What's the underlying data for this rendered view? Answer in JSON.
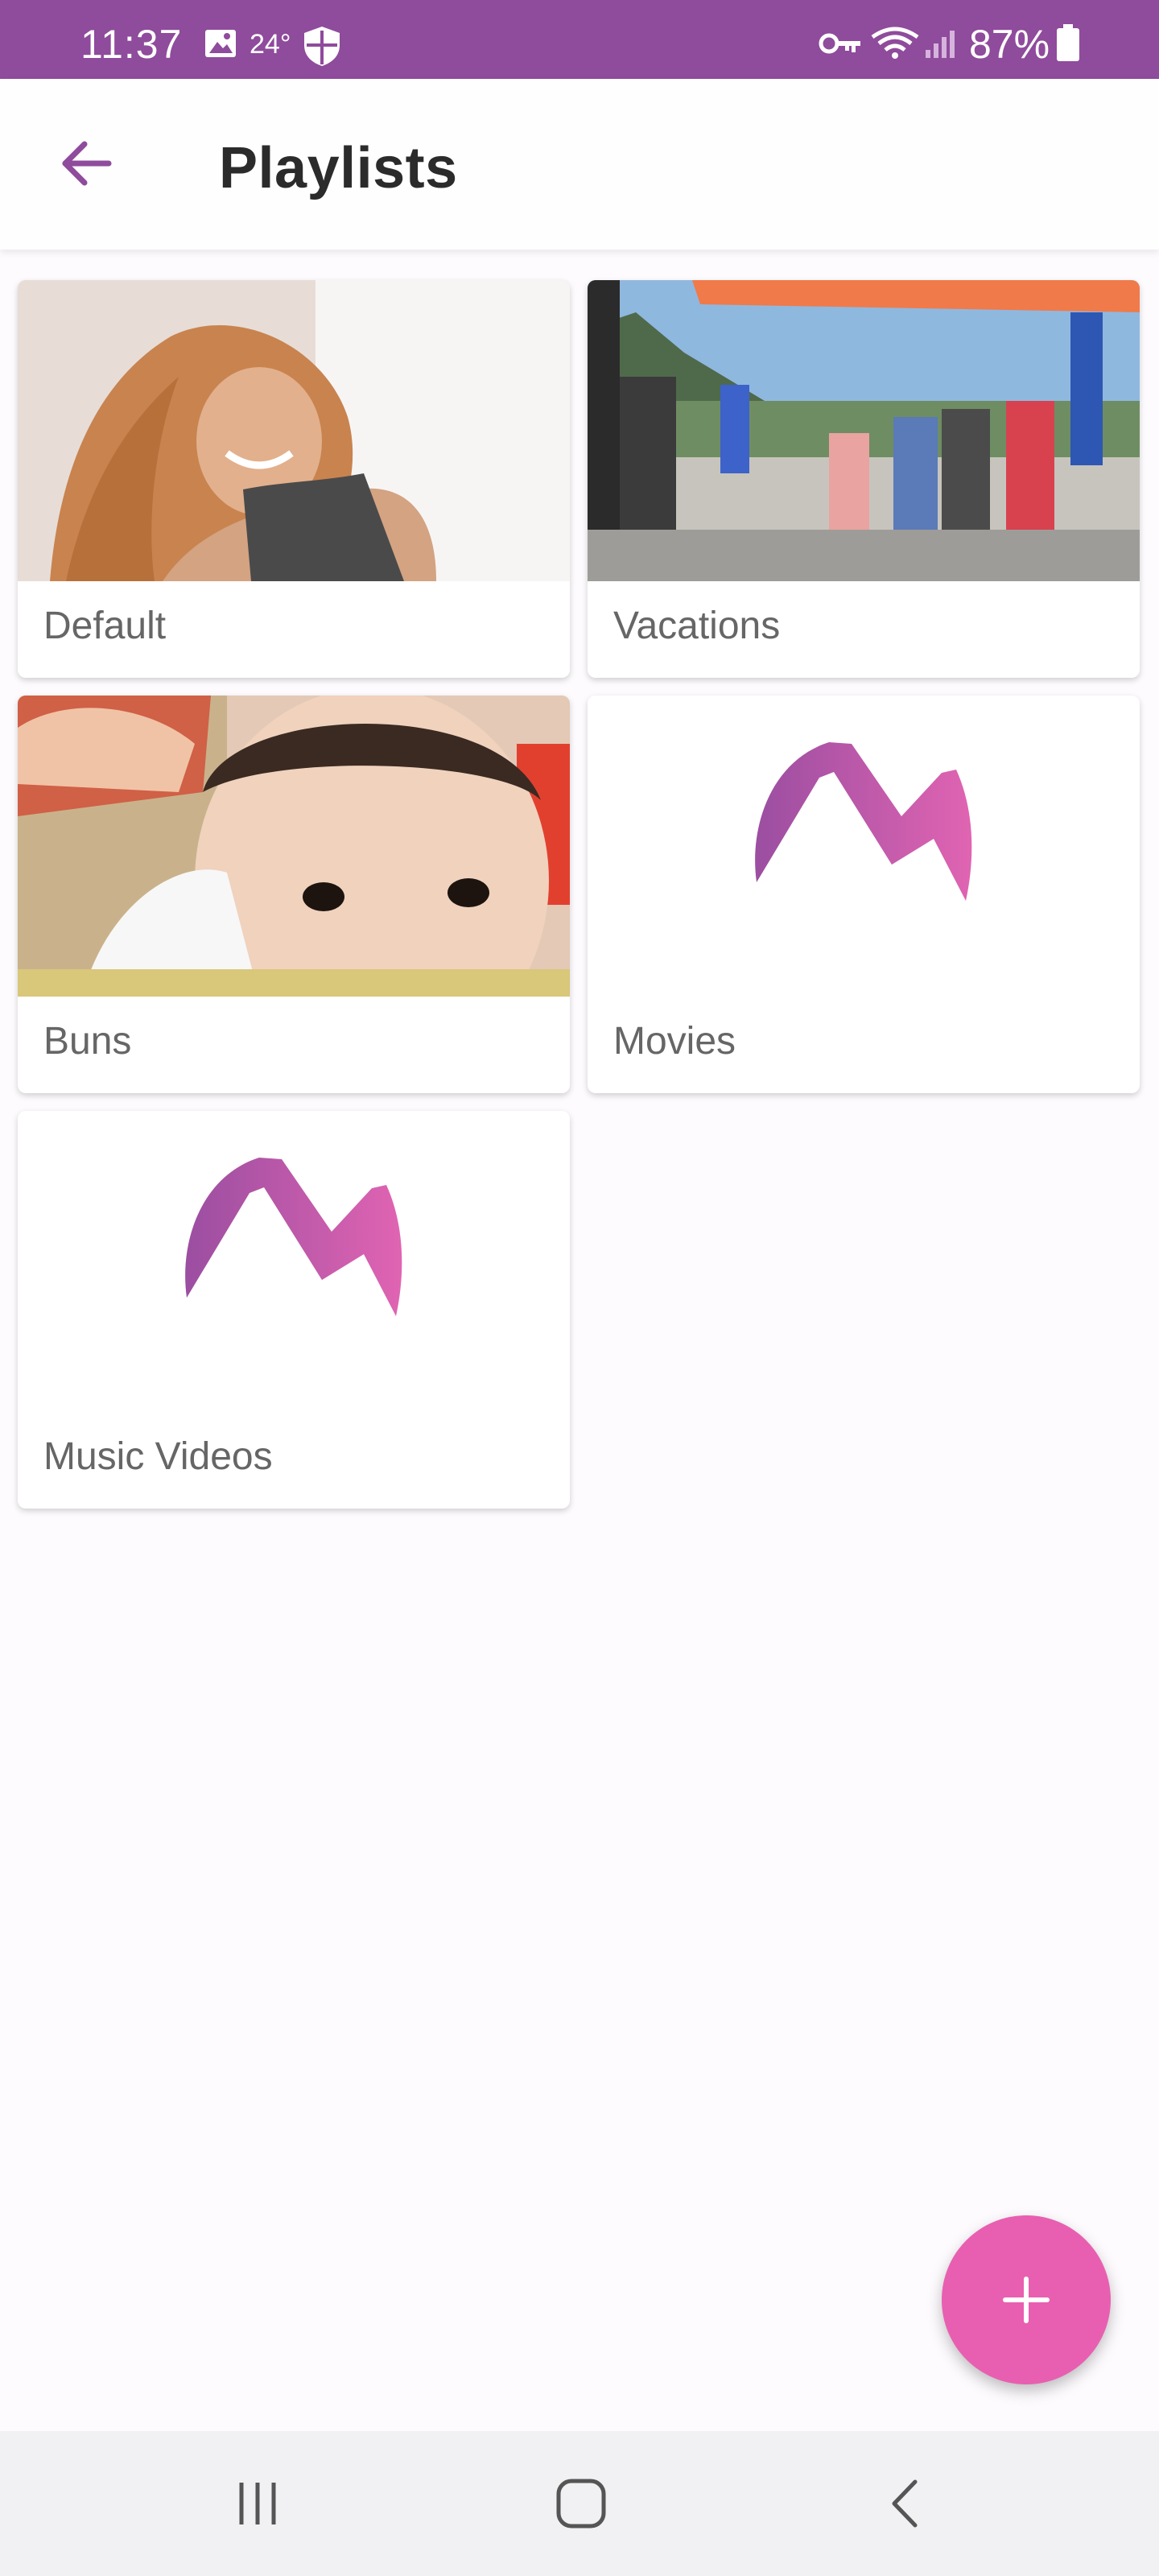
{
  "status_bar": {
    "time": "11:37",
    "temperature": "24°",
    "battery": "87%",
    "background_color": "#8f4b9c",
    "icons": [
      "image-icon",
      "shield-icon",
      "key-icon",
      "wifi-icon",
      "signal-icon",
      "battery-icon"
    ]
  },
  "app_bar": {
    "title": "Playlists",
    "back_icon": "arrow-left-icon",
    "accent_color": "#8f4b9c"
  },
  "playlists": [
    {
      "name": "Default",
      "thumbnail": "photo-woman-smiling"
    },
    {
      "name": "Vacations",
      "thumbnail": "photo-group-on-boat"
    },
    {
      "name": "Buns",
      "thumbnail": "photo-baby-face"
    },
    {
      "name": "Movies",
      "thumbnail": "app-logo-m"
    },
    {
      "name": "Music Videos",
      "thumbnail": "app-logo-m"
    }
  ],
  "fab": {
    "icon": "plus-icon",
    "color": "#e85fb1"
  },
  "nav_bar": {
    "icons": [
      "recent-apps-icon",
      "home-icon",
      "back-icon"
    ]
  }
}
